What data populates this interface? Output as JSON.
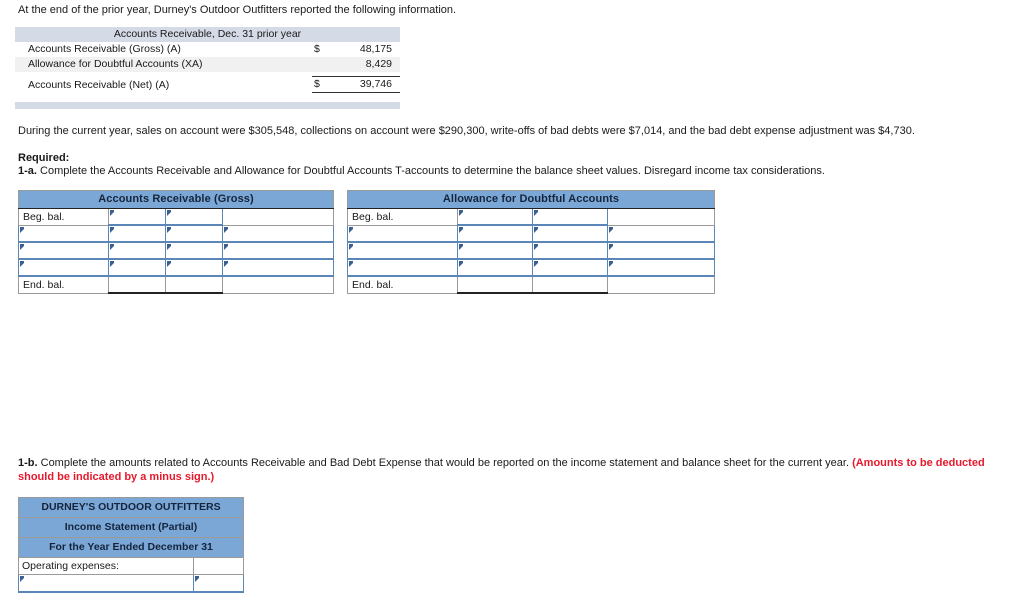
{
  "intro": {
    "text": "At the end of the prior year, Durney's Outdoor Outfitters reported the following information."
  },
  "prior_year_table": {
    "header": "Accounts Receivable, Dec. 31 prior year",
    "rows": [
      {
        "label": "Accounts Receivable (Gross) (A)",
        "symbol": "$",
        "amount": "48,175"
      },
      {
        "label": "Allowance for Doubtful Accounts (XA)",
        "symbol": "",
        "amount": "8,429"
      },
      {
        "label": "Accounts Receivable (Net) (A)",
        "symbol": "$",
        "amount": "39,746"
      }
    ]
  },
  "paragraphs": {
    "during": "During the current year, sales on account were $305,548, collections on account were $290,300, write-offs of bad debts were $7,014, and the bad debt expense adjustment was $4,730.",
    "required_label": "Required:",
    "item_1a_num": "1-a.",
    "item_1a_text": " Complete the Accounts Receivable and Allowance for Doubtful Accounts T-accounts to determine the balance sheet values. Disregard income tax considerations.",
    "item_1b_num": "1-b.",
    "item_1b_text": " Complete the amounts related to Accounts Receivable and Bad Debt Expense that would be reported on the income statement and balance sheet for the current year. ",
    "item_1b_note": "(Amounts to be deducted should be indicated by a minus sign.)"
  },
  "t_accounts": [
    {
      "id": "accounts-receivable-gross",
      "title": "Accounts Receivable (Gross)",
      "beg_label": "Beg. bal.",
      "end_label": "End. bal.",
      "beg_value": "",
      "end_value": "",
      "entry_rows": 3,
      "columns": 4
    },
    {
      "id": "allowance-for-doubtful-accounts",
      "title": "Allowance for Doubtful Accounts",
      "beg_label": "Beg. bal.",
      "end_label": "End. bal.",
      "beg_value": "",
      "end_value": "",
      "entry_rows": 3,
      "columns": 4
    }
  ],
  "income_statement": {
    "company": "DURNEY'S OUTDOOR OUTFITTERS",
    "statement": "Income Statement (Partial)",
    "period": "For the Year Ended December 31",
    "row_label": "Operating expenses:",
    "row_value": "",
    "entry_label": "",
    "entry_value": ""
  },
  "colors": {
    "header_blue": "#7ba7d7",
    "summary_header_gray": "#d5dbe6",
    "input_border_blue": "#5b86b8",
    "input_marker_blue": "#3a5f91",
    "note_red": "#e8192c"
  }
}
